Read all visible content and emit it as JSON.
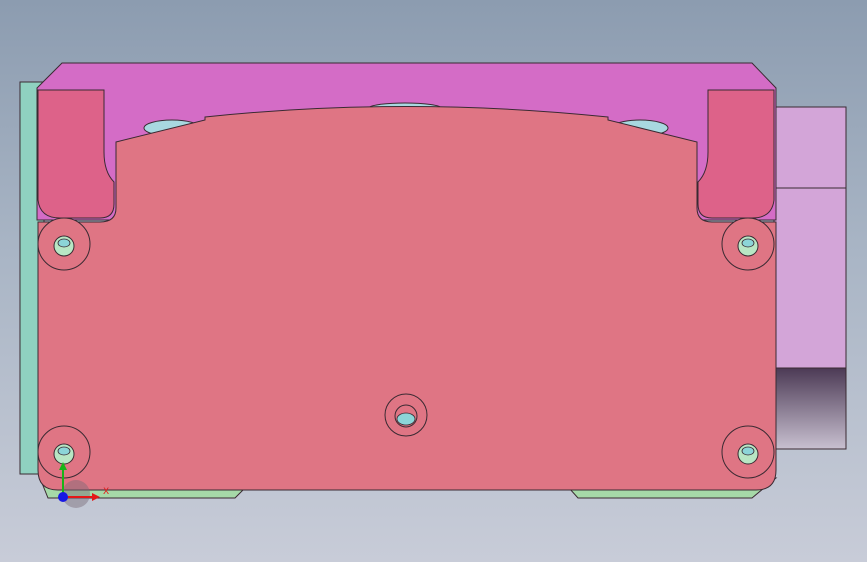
{
  "viewport": {
    "colors": {
      "background_top": "#8c9cb0",
      "background_bottom": "#c8ccd8",
      "clamp_body": "#d46cc6",
      "main_plate": "#df7584",
      "jaw_blocks": "#dd6289",
      "side_block": "#d3a5d8",
      "left_plate": "#8fd1c0",
      "base_rail": "#a6d9a8",
      "screw_head": "#b8e6c4",
      "screw_socket": "#8cd5d8",
      "edge": "#3a2a32"
    },
    "icons": {
      "screw": "hex-socket-screw-icon",
      "center_hole": "center-hole-icon",
      "triad": "coordinate-triad-icon"
    }
  },
  "triad": {
    "x_label": "X",
    "x_color": "#e41818",
    "y_color": "#18b418",
    "z_color": "#1818e4"
  }
}
